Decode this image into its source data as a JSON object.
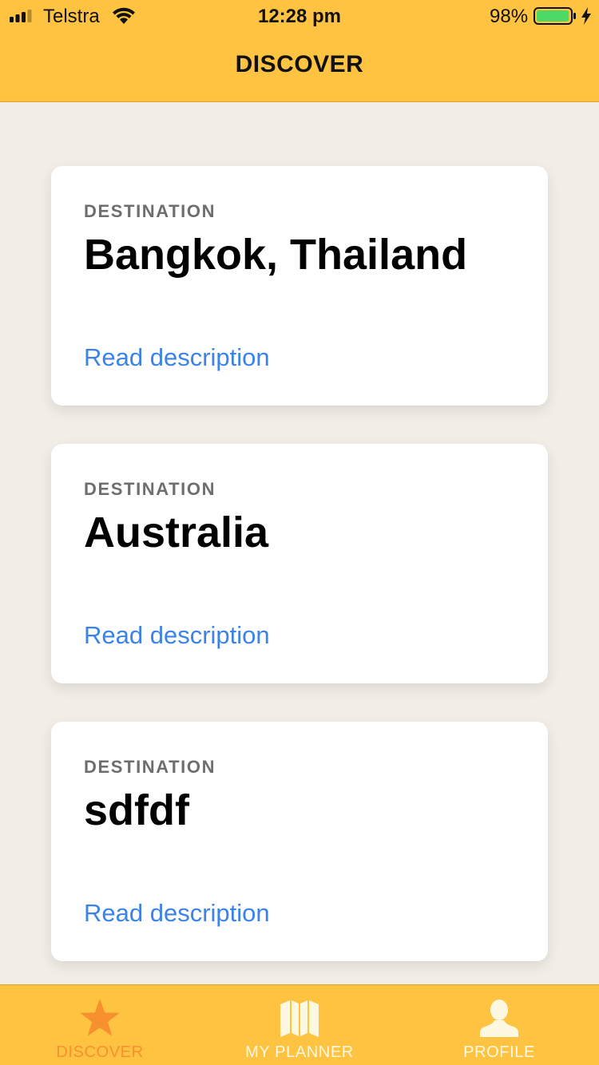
{
  "status_bar": {
    "carrier": "Telstra",
    "time": "12:28 pm",
    "battery_percent": "98%",
    "battery_level": 0.98
  },
  "nav": {
    "title": "DISCOVER"
  },
  "cards": [
    {
      "kicker": "DESTINATION",
      "title": "Bangkok, Thailand",
      "link": "Read description"
    },
    {
      "kicker": "DESTINATION",
      "title": "Australia",
      "link": "Read description"
    },
    {
      "kicker": "DESTINATION",
      "title": "sdfdf",
      "link": "Read description"
    }
  ],
  "tabs": [
    {
      "label": "DISCOVER",
      "icon": "star-icon",
      "active": true
    },
    {
      "label": "MY PLANNER",
      "icon": "map-icon",
      "active": false
    },
    {
      "label": "PROFILE",
      "icon": "user-icon",
      "active": false
    }
  ],
  "colors": {
    "brand": "#ffc342",
    "background": "#f2eee7",
    "link": "#3b83e8",
    "active_tab": "#f7902f",
    "inactive_tab": "#fff8e1"
  }
}
